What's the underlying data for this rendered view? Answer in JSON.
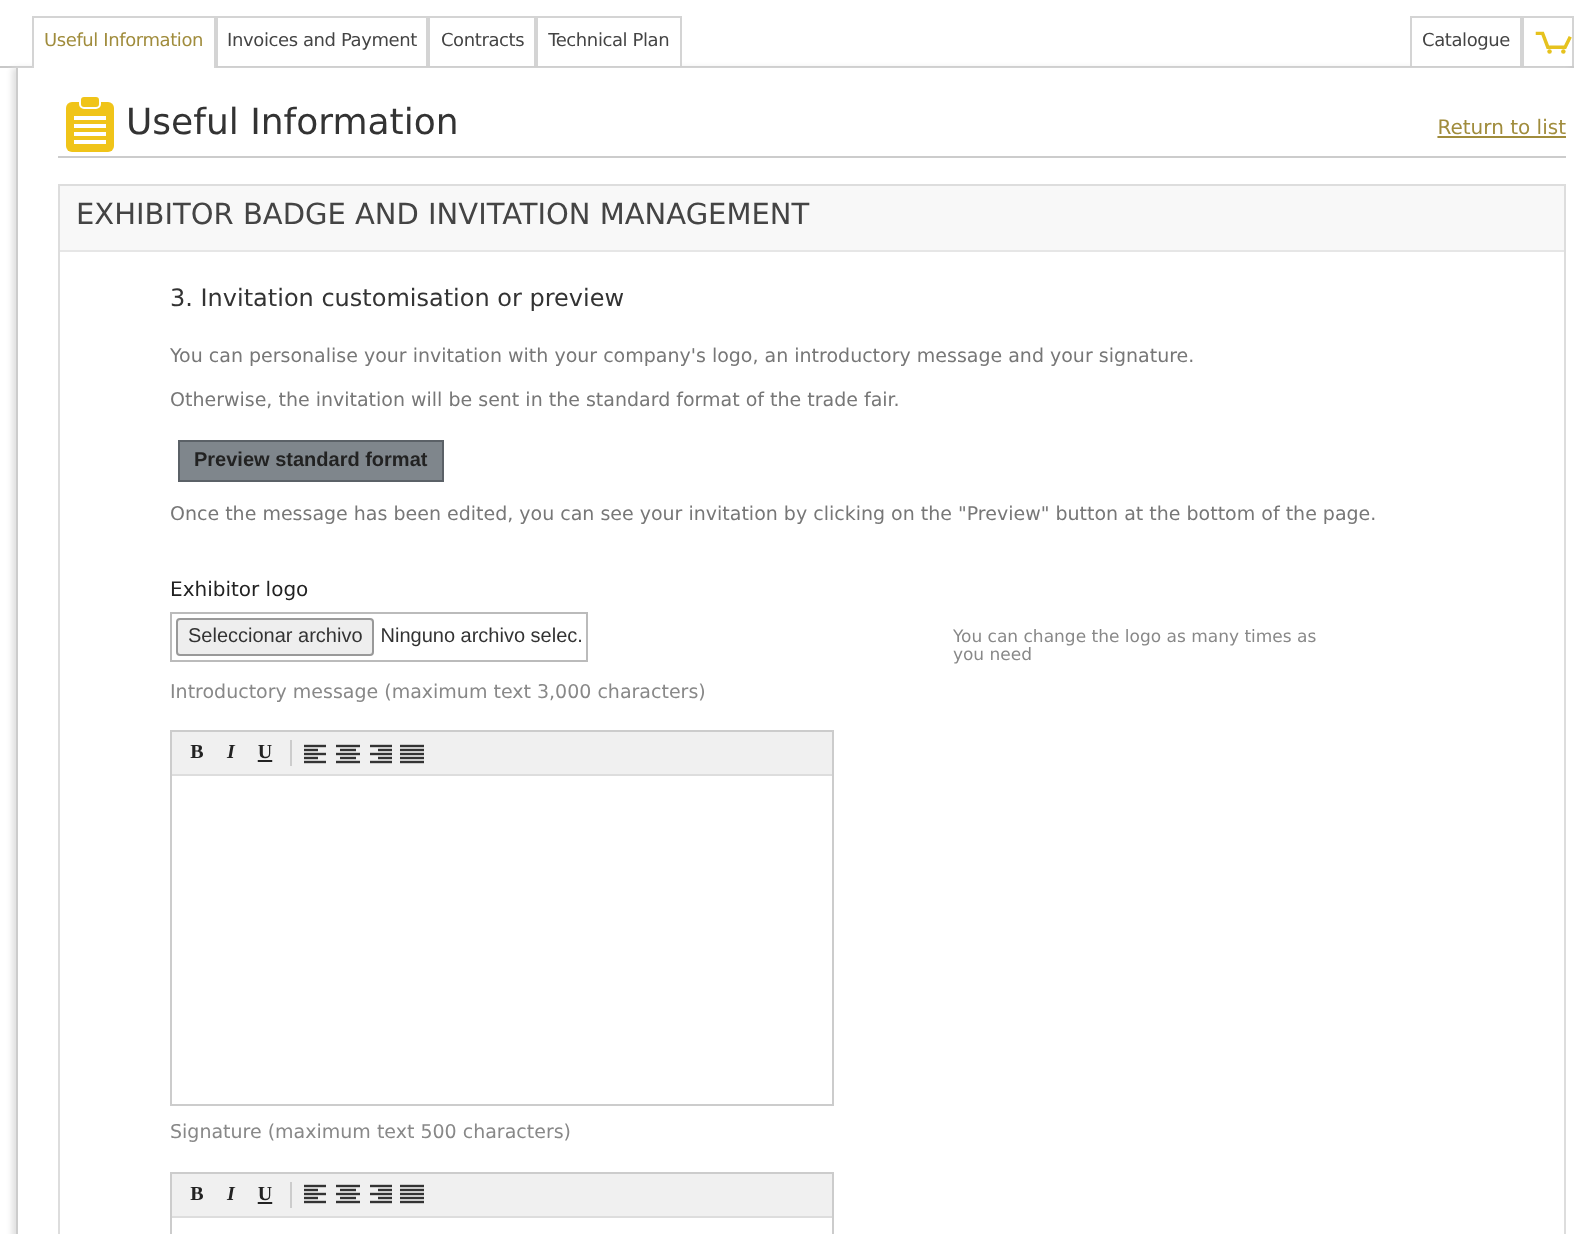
{
  "tabs": [
    {
      "label": "Useful Information",
      "selected": true
    },
    {
      "label": "Invoices and Payment",
      "selected": false
    },
    {
      "label": "Contracts",
      "selected": false
    },
    {
      "label": "Technical Plan",
      "selected": false
    }
  ],
  "right_tabs": [
    {
      "label": "Catalogue",
      "selected": false
    }
  ],
  "page_title": "Useful Information",
  "return_link": "Return to list",
  "section": {
    "header": "EXHIBITOR BADGE AND INVITATION MANAGEMENT",
    "step_heading": "3. Invitation customisation or preview",
    "intro": [
      "You can personalise your invitation with your company's logo, an introductory message and your signature.",
      "Otherwise, the invitation will be sent in the standard format of the trade fair."
    ],
    "preview_button": "Preview standard format",
    "note": "Once the message has been edited, you can see your invitation by clicking on the \"Preview\" button at the bottom of the page.",
    "logo": {
      "label": "Exhibitor logo",
      "file_button": "Seleccionar archivo",
      "file_status": "Ninguno archivo selec.",
      "hint": "You can change the logo as many times as you need"
    },
    "editors": [
      {
        "label": "Introductory message (maximum text 3,000 characters)",
        "toolbar": [
          "B",
          "I",
          "U"
        ]
      },
      {
        "label": "Signature (maximum text 500 characters)",
        "toolbar": [
          "B",
          "I",
          "U"
        ]
      }
    ]
  }
}
